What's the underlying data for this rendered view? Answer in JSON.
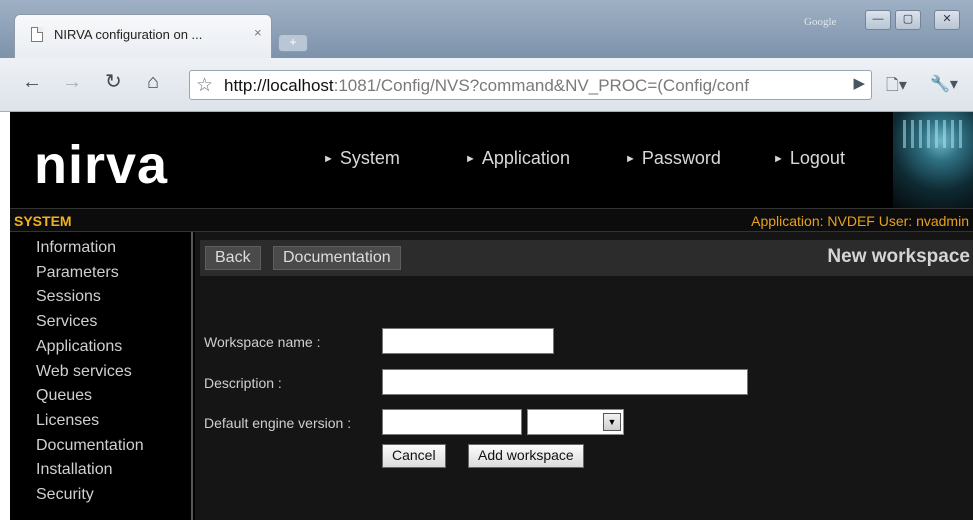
{
  "browser": {
    "tab_title": "NIRVA configuration on ...",
    "tab_close": "×",
    "new_tab": "+",
    "search_label": "Google",
    "win_minimize": "—",
    "win_maximize": "▢",
    "win_close": "✕",
    "url_host": "http://localhost",
    "url_rest": ":1081/Config/NVS?command&NV_PROC=(Config/conf"
  },
  "header": {
    "logo": "nirva",
    "nav": [
      "System",
      "Application",
      "Password",
      "Logout"
    ]
  },
  "statusbar": {
    "section": "SYSTEM",
    "info": "Application: NVDEF  User: nvadmin"
  },
  "sidebar": {
    "items": [
      "Information",
      "Parameters",
      "Sessions",
      "Services",
      "Applications",
      "Web services",
      "Queues",
      "Licenses",
      "Documentation",
      "Installation",
      "Security"
    ]
  },
  "actions": {
    "back": "Back",
    "documentation": "Documentation",
    "page_title": "New workspace"
  },
  "form": {
    "workspace_name_label": "Workspace name :",
    "workspace_name_value": "",
    "description_label": "Description :",
    "description_value": "",
    "engine_version_label": "Default engine version :",
    "engine_version_value": "",
    "engine_select_value": "",
    "cancel": "Cancel",
    "add_workspace": "Add workspace"
  },
  "colors": {
    "accent": "#f3b01e",
    "page_bg": "#000000",
    "content_bg": "#151515"
  }
}
